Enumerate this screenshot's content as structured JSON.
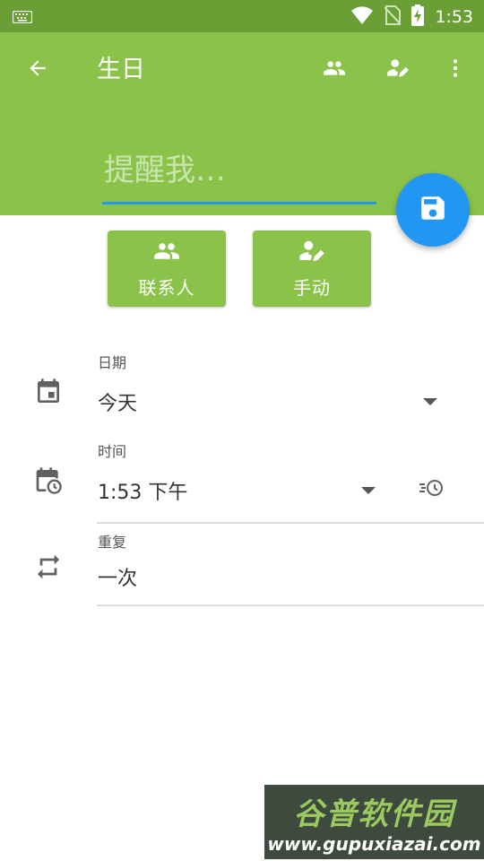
{
  "status_bar": {
    "time": "1:53"
  },
  "toolbar": {
    "title": "生日",
    "back_icon": "arrow-back-icon",
    "contacts_icon": "people-icon",
    "edit_icon": "edit-person-icon",
    "more_icon": "more-vert-icon"
  },
  "reminder": {
    "placeholder": "提醒我…"
  },
  "fab": {
    "icon": "save-icon",
    "color": "#2196f3"
  },
  "chips": [
    {
      "label": "联系人",
      "icon": "people-icon"
    },
    {
      "label": "手动",
      "icon": "edit-person-icon"
    }
  ],
  "fields": {
    "date": {
      "label": "日期",
      "value": "今天",
      "icon": "calendar-icon"
    },
    "time": {
      "label": "时间",
      "value": "1:53 下午",
      "icon": "calendar-clock-icon",
      "history_icon": "history-icon"
    },
    "repeat": {
      "label": "重复",
      "value": "一次",
      "icon": "repeat-icon"
    }
  },
  "watermark": {
    "title": "谷普软件园",
    "url": "www.gupuxiazai.com"
  },
  "colors": {
    "primary": "#8bc34a",
    "primary_dark": "#6a9f36",
    "accent": "#2196f3"
  }
}
